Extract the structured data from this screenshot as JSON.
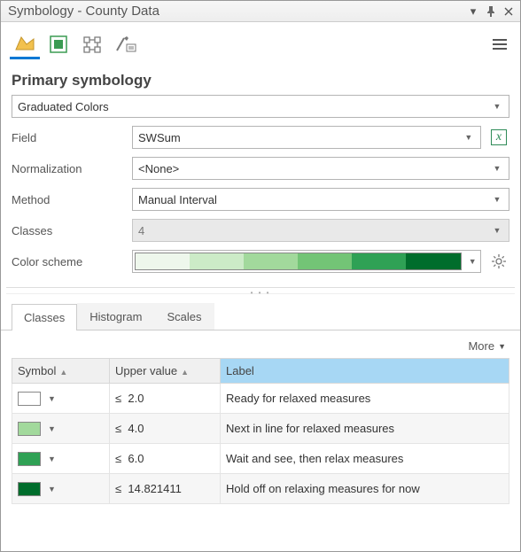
{
  "window": {
    "title": "Symbology - County Data"
  },
  "toolbar": {
    "tabs": [
      "primary",
      "vary-by-attribute",
      "symbol-layers",
      "advanced"
    ],
    "active": 0
  },
  "section_heading": "Primary symbology",
  "primary_combo": "Graduated Colors",
  "fields": {
    "field_label": "Field",
    "field_value": "SWSum",
    "normalization_label": "Normalization",
    "normalization_value": "<None>",
    "method_label": "Method",
    "method_value": "Manual Interval",
    "classes_label": "Classes",
    "classes_value": "4",
    "colorscheme_label": "Color scheme"
  },
  "ramp": [
    "#eef7ec",
    "#ccebc7",
    "#a2d99c",
    "#73c476",
    "#2fa155",
    "#006d2c"
  ],
  "subtabs": {
    "items": [
      "Classes",
      "Histogram",
      "Scales"
    ],
    "active": 0
  },
  "more_label": "More",
  "table": {
    "headers": {
      "symbol": "Symbol",
      "upper": "Upper value",
      "label": "Label"
    },
    "rows": [
      {
        "color": "#ffffff",
        "op": "≤",
        "value": "2.0",
        "label": "Ready for relaxed measures"
      },
      {
        "color": "#a2d99c",
        "op": "≤",
        "value": "4.0",
        "label": "Next in line for relaxed measures"
      },
      {
        "color": "#2fa155",
        "op": "≤",
        "value": "6.0",
        "label": "Wait and see, then relax measures"
      },
      {
        "color": "#006d2c",
        "op": "≤",
        "value": "14.821411",
        "label": "Hold off on relaxing measures for now"
      }
    ]
  }
}
